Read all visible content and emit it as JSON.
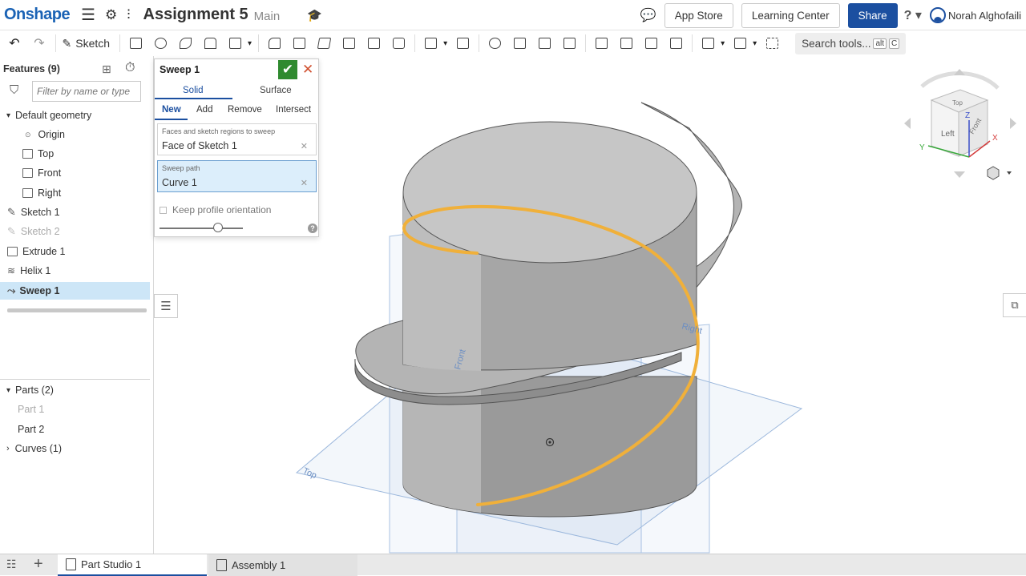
{
  "app": {
    "logo": "Onshape",
    "doc_title": "Assignment 5",
    "branch": "Main",
    "app_store": "App Store",
    "learning_center": "Learning Center",
    "share": "Share",
    "user_name": "Norah Alghofaili",
    "help": "?"
  },
  "toolbar": {
    "sketch_label": "Sketch",
    "search_label": "Search tools...",
    "search_key1": "alt",
    "search_key2": "C"
  },
  "features": {
    "title": "Features (9)",
    "filter_placeholder": "Filter by name or type",
    "default_geometry": "Default geometry",
    "items": [
      "Origin",
      "Top",
      "Front",
      "Right",
      "Sketch 1",
      "Sketch 2",
      "Extrude 1",
      "Helix 1",
      "Sweep 1"
    ],
    "parts_header": "Parts (2)",
    "parts": [
      "Part 1",
      "Part 2"
    ],
    "curves_header": "Curves (1)"
  },
  "sweep": {
    "title": "Sweep 1",
    "tabs": [
      "Solid",
      "Surface"
    ],
    "ops": [
      "New",
      "Add",
      "Remove",
      "Intersect"
    ],
    "faces_label": "Faces and sketch regions to sweep",
    "faces_value": "Face of Sketch 1",
    "path_label": "Sweep path",
    "path_value": "Curve 1",
    "keep_orientation": "Keep profile orientation"
  },
  "viewport": {
    "plane_labels": [
      "Front",
      "Top",
      "Right"
    ],
    "cube_faces": [
      "Top",
      "Left",
      "Front"
    ],
    "axes": [
      "X",
      "Y",
      "Z"
    ]
  },
  "bottom_tabs": [
    "Part Studio 1",
    "Assembly 1"
  ],
  "colors": {
    "brand": "#1b63b5",
    "share": "#1b4fa0",
    "helix": "#f0b03a",
    "selected": "#cde6f7"
  }
}
